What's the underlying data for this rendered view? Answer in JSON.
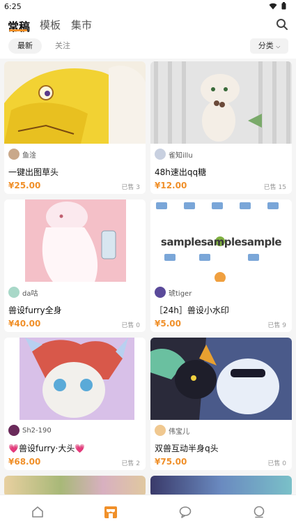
{
  "status_bar": {
    "time": "6:25"
  },
  "header": {
    "tabs": [
      {
        "label": "常稿"
      },
      {
        "label": "模板"
      },
      {
        "label": "集市"
      }
    ],
    "active_tab": "常稿"
  },
  "filters": {
    "latest": "最新",
    "following": "关注",
    "category": "分类"
  },
  "accent_color": "#f0902a",
  "cards": [
    {
      "seller": "鱼淦",
      "title": "一键出图草头",
      "price": "¥25.00",
      "sold": "已售 3"
    },
    {
      "seller": "雀知illu",
      "title": "48h速出qq糖",
      "price": "¥12.00",
      "sold": "已售 15"
    },
    {
      "seller": "da咕",
      "title": "兽设furry全身",
      "price": "¥40.00",
      "sold": "已售 0"
    },
    {
      "seller": "琥tiger",
      "title": "［24h］兽设小水印",
      "price": "¥5.00",
      "sold": "已售 9"
    },
    {
      "seller": "Sh2-190",
      "title": "💗兽设furry·大头💗",
      "price": "¥68.00",
      "sold": "已售 2"
    },
    {
      "seller": "伟宝儿",
      "title": "双兽互动半身q头",
      "price": "¥75.00",
      "sold": "已售 0"
    }
  ],
  "watermark_text": "sample",
  "bottom_nav": [
    {
      "icon": "home-icon"
    },
    {
      "icon": "shop-icon",
      "active": true
    },
    {
      "icon": "chat-icon"
    },
    {
      "icon": "profile-icon"
    }
  ]
}
